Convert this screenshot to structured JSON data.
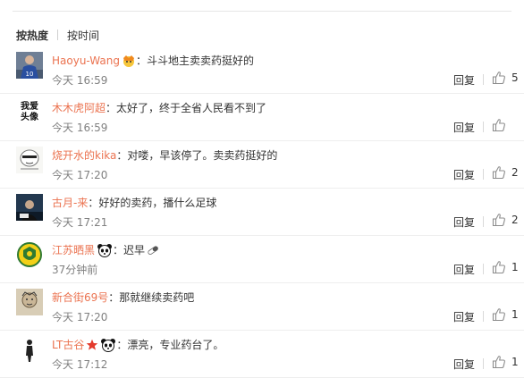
{
  "sort": {
    "hot_label": "按热度",
    "time_label": "按时间"
  },
  "comments": [
    {
      "user": "Haoyu-Wang",
      "badges": [
        "crown"
      ],
      "colon": "：",
      "text": "斗斗地主卖卖药挺好的",
      "time": "今天 16:59",
      "reply": "回复",
      "likes": "5",
      "avatar": "soccer-player"
    },
    {
      "user": "木木虎阿超",
      "badges": [],
      "colon": "：",
      "text": "太好了，终于全省人民看不到了",
      "time": "今天 16:59",
      "reply": "回复",
      "likes": "",
      "avatar": "default-text",
      "avatar_text": [
        "我爱",
        "头像"
      ]
    },
    {
      "user": "烧开水的kika",
      "badges": [],
      "colon": "：",
      "text": "对喽，早该停了。卖卖药挺好的",
      "time": "今天 17:20",
      "reply": "回复",
      "likes": "2",
      "avatar": "cartoon-face"
    },
    {
      "user": "古月-来",
      "badges": [],
      "colon": "：",
      "text": "好好的卖药，播什么足球",
      "time": "今天 17:21",
      "reply": "回复",
      "likes": "2",
      "avatar": "photo"
    },
    {
      "user": "江苏晒黑",
      "badges": [
        "panda"
      ],
      "colon": "：",
      "text": "迟早",
      "text_icon": "pill",
      "time": "37分钟前",
      "reply": "回复",
      "likes": "1",
      "avatar": "team-crest"
    },
    {
      "user": "新合街69号",
      "badges": [],
      "colon": "：",
      "text": "那就继续卖药吧",
      "time": "今天 17:20",
      "reply": "回复",
      "likes": "1",
      "avatar": "portrait"
    },
    {
      "user": "LT古谷",
      "badges": [
        "star",
        "panda"
      ],
      "colon": "：",
      "text": "漂亮，专业药台了。",
      "time": "今天 17:12",
      "reply": "回复",
      "likes": "1",
      "avatar": "silhouette"
    }
  ],
  "colors": {
    "username": "#eb7350",
    "time": "#808080",
    "text": "#333333"
  }
}
